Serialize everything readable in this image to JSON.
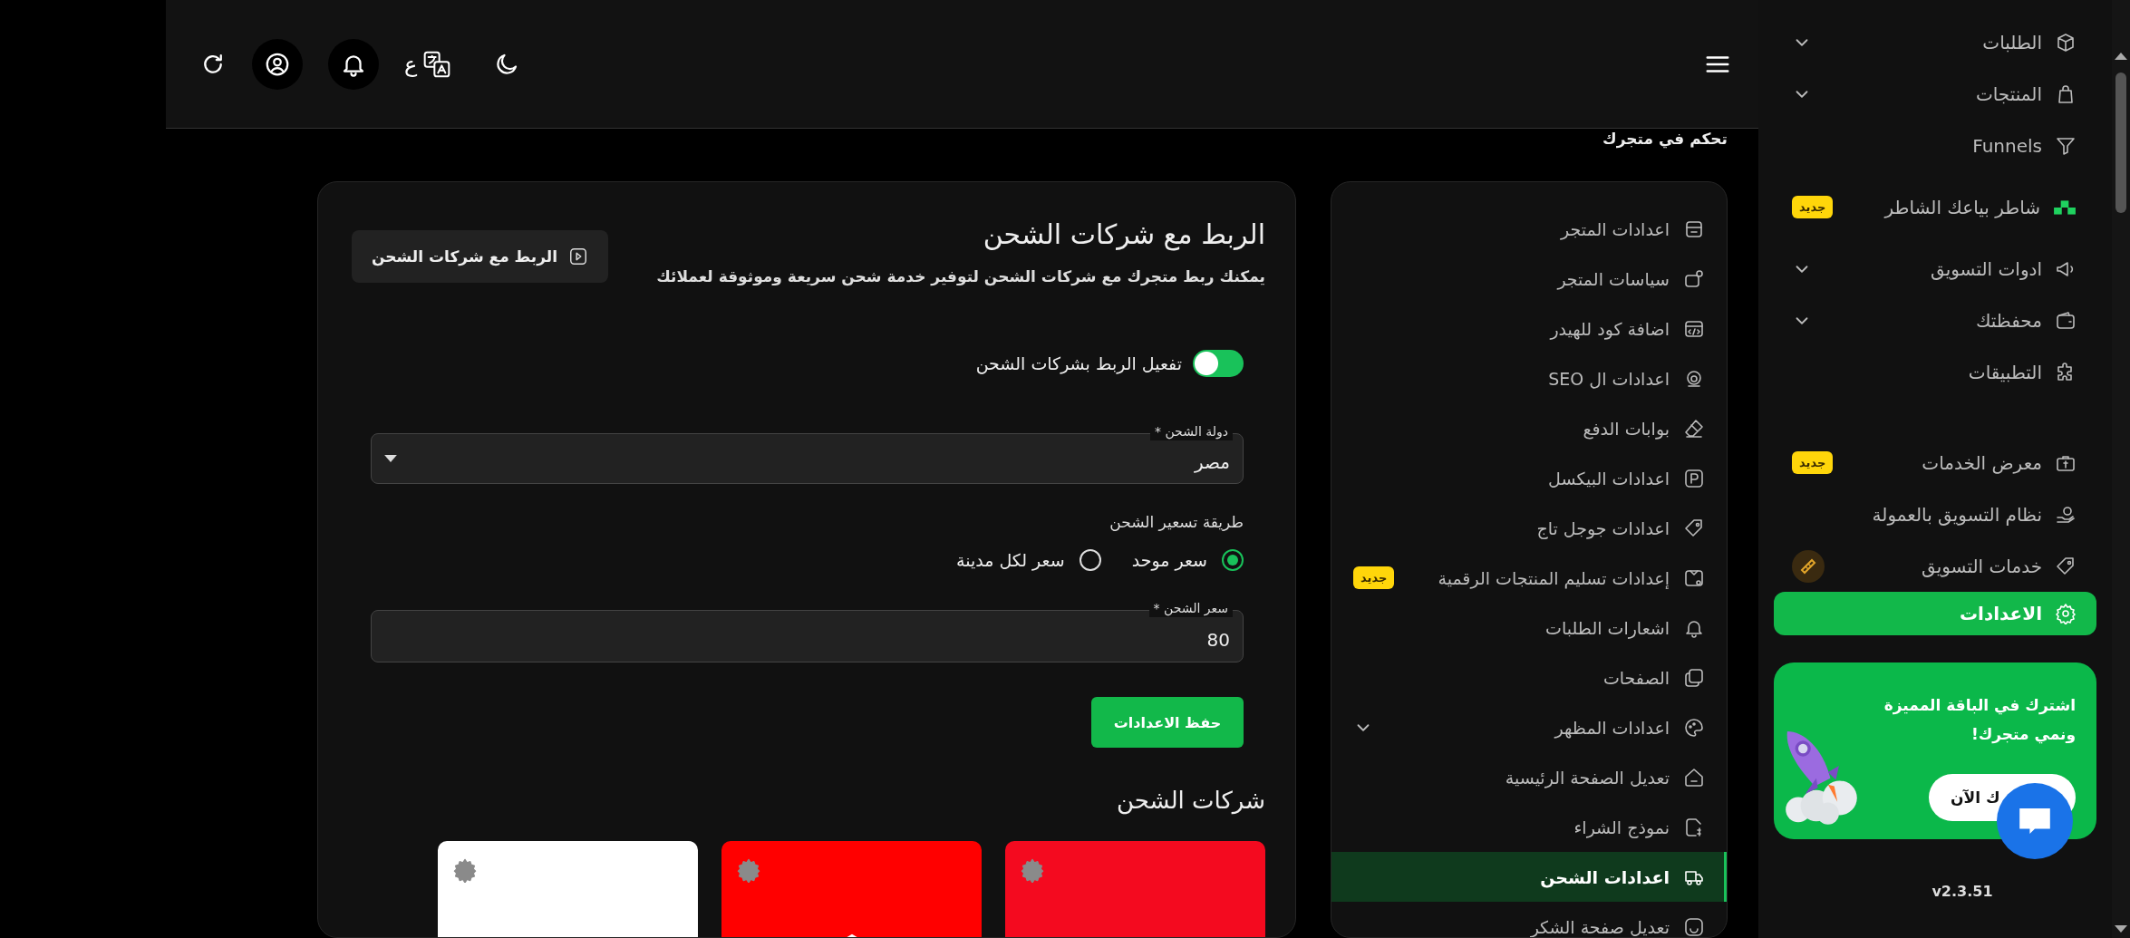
{
  "sidebar": {
    "sections": [
      {
        "items": [
          {
            "label": "الطلبات",
            "kind": "menu",
            "selected": false
          },
          {
            "label": "المنتجات",
            "kind": "menu",
            "selected": false
          },
          {
            "label": "Funnels",
            "kind": "link",
            "selected": false
          },
          {
            "label": "شاطر بياعك الشاطر",
            "kind": "new",
            "badge": "جديد",
            "selected": false
          },
          {
            "label": "ادوات التسويق",
            "kind": "menu",
            "selected": false
          },
          {
            "label": "محفظتك",
            "kind": "menu",
            "selected": false
          },
          {
            "label": "التطبيقات",
            "kind": "link",
            "selected": false
          }
        ]
      },
      {
        "items": [
          {
            "label": "معرض الخدمات",
            "kind": "new",
            "badge": "جديد",
            "selected": false
          },
          {
            "label": "نظام التسويق بالعمولة",
            "kind": "link",
            "selected": false
          },
          {
            "label": "خدمات التسويق",
            "kind": "promo",
            "selected": false
          },
          {
            "label": "الاعدادات",
            "kind": "link",
            "selected": true
          }
        ]
      }
    ],
    "promo": {
      "text": "اشترك في الباقة المميزة ونمي متجرك!",
      "button": "ك الآن"
    },
    "version": "v2.3.51"
  },
  "topbar": {
    "language_label": "ع"
  },
  "settings_menu": {
    "heading": "تحكم في متجرك",
    "items": [
      {
        "label": "اعدادات المتجر",
        "kind": "link",
        "selected": false
      },
      {
        "label": "سياسات المتجر",
        "kind": "link",
        "selected": false
      },
      {
        "label": "اضافة كود للهيدر",
        "kind": "link",
        "selected": false
      },
      {
        "label": "اعدادات ال SEO",
        "kind": "link",
        "selected": false
      },
      {
        "label": "بوابات الدفع",
        "kind": "link",
        "selected": false
      },
      {
        "label": "اعدادات البيكسل",
        "kind": "link",
        "selected": false
      },
      {
        "label": "اعدادات جوجل تاج",
        "kind": "link",
        "selected": false
      },
      {
        "label": "إعدادات تسليم المنتجات الرقمية",
        "kind": "new",
        "badge": "جديد",
        "selected": false
      },
      {
        "label": "اشعارات الطلبات",
        "kind": "link",
        "selected": false
      },
      {
        "label": "الصفحات",
        "kind": "link",
        "selected": false
      },
      {
        "label": "اعدادات المظهر",
        "kind": "menu",
        "selected": false
      },
      {
        "label": "تعديل الصفحة الرئيسية",
        "kind": "link",
        "selected": false
      },
      {
        "label": "نموذج الشراء",
        "kind": "link",
        "selected": false
      },
      {
        "label": "اعدادات الشحن",
        "kind": "link",
        "selected": true
      },
      {
        "label": "تعديل صفحة الشكر",
        "kind": "link",
        "selected": false
      }
    ]
  },
  "shipping": {
    "title": "الربط مع شركات الشحن",
    "description": "يمكنك ربط متجرك مع شركات الشحن لتوفير خدمة شحن سريعة وموثوقة لعملائك",
    "video_button": "الربط مع شركات الشحن",
    "toggle": {
      "label": "تفعيل الربط بشركات الشحن",
      "on": true
    },
    "country_field": {
      "label": "دولة الشحن *",
      "value": "مصر"
    },
    "pricing": {
      "label": "طريقة تسعير الشحن",
      "options": [
        {
          "label": "سعر موحد",
          "selected": true
        },
        {
          "label": "سعر لكل مدينة",
          "selected": false
        }
      ]
    },
    "price_field": {
      "label": "سعر الشحن *",
      "value": "80"
    },
    "save_button": "حفظ الاعدادات",
    "companies_heading": "شركات الشحن",
    "companies": [
      {
        "kind": "plain",
        "color": "#f40a1f"
      },
      {
        "kind": "roof",
        "color": "#ff0000"
      },
      {
        "kind": "plain",
        "color": "#ffffff"
      }
    ]
  }
}
